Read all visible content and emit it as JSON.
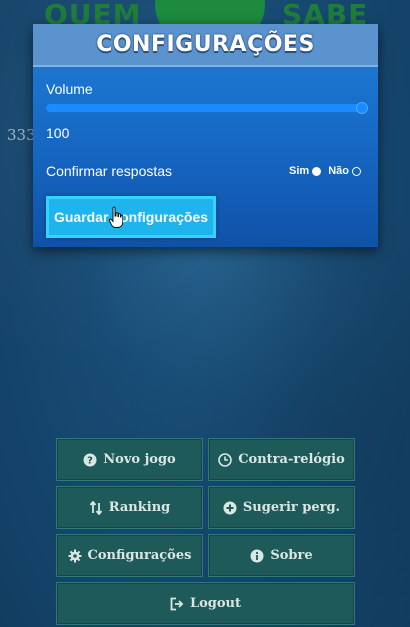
{
  "background": {
    "logo_left": "QUEM",
    "logo_right": "SABE",
    "counter": "333"
  },
  "settings": {
    "title": "CONFIGURAÇÕES",
    "volume_label": "Volume",
    "volume_value": "100",
    "volume_level": 1.0,
    "confirm_label": "Confirmar respostas",
    "confirm_options": [
      {
        "label": "Sim",
        "checked": true
      },
      {
        "label": "Não",
        "checked": false
      }
    ],
    "save_button": "Guardar configurações"
  },
  "menu": {
    "new_game": "Novo jogo",
    "time_trial": "Contra-relógio",
    "ranking": "Ranking",
    "suggest": "Sugerir perg.",
    "settings": "Configurações",
    "about": "Sobre",
    "logout": "Logout"
  },
  "colors": {
    "modal_accent": "#1565c0",
    "save_button": "#1fb4ee",
    "menu_button": "#1f5a5a"
  }
}
